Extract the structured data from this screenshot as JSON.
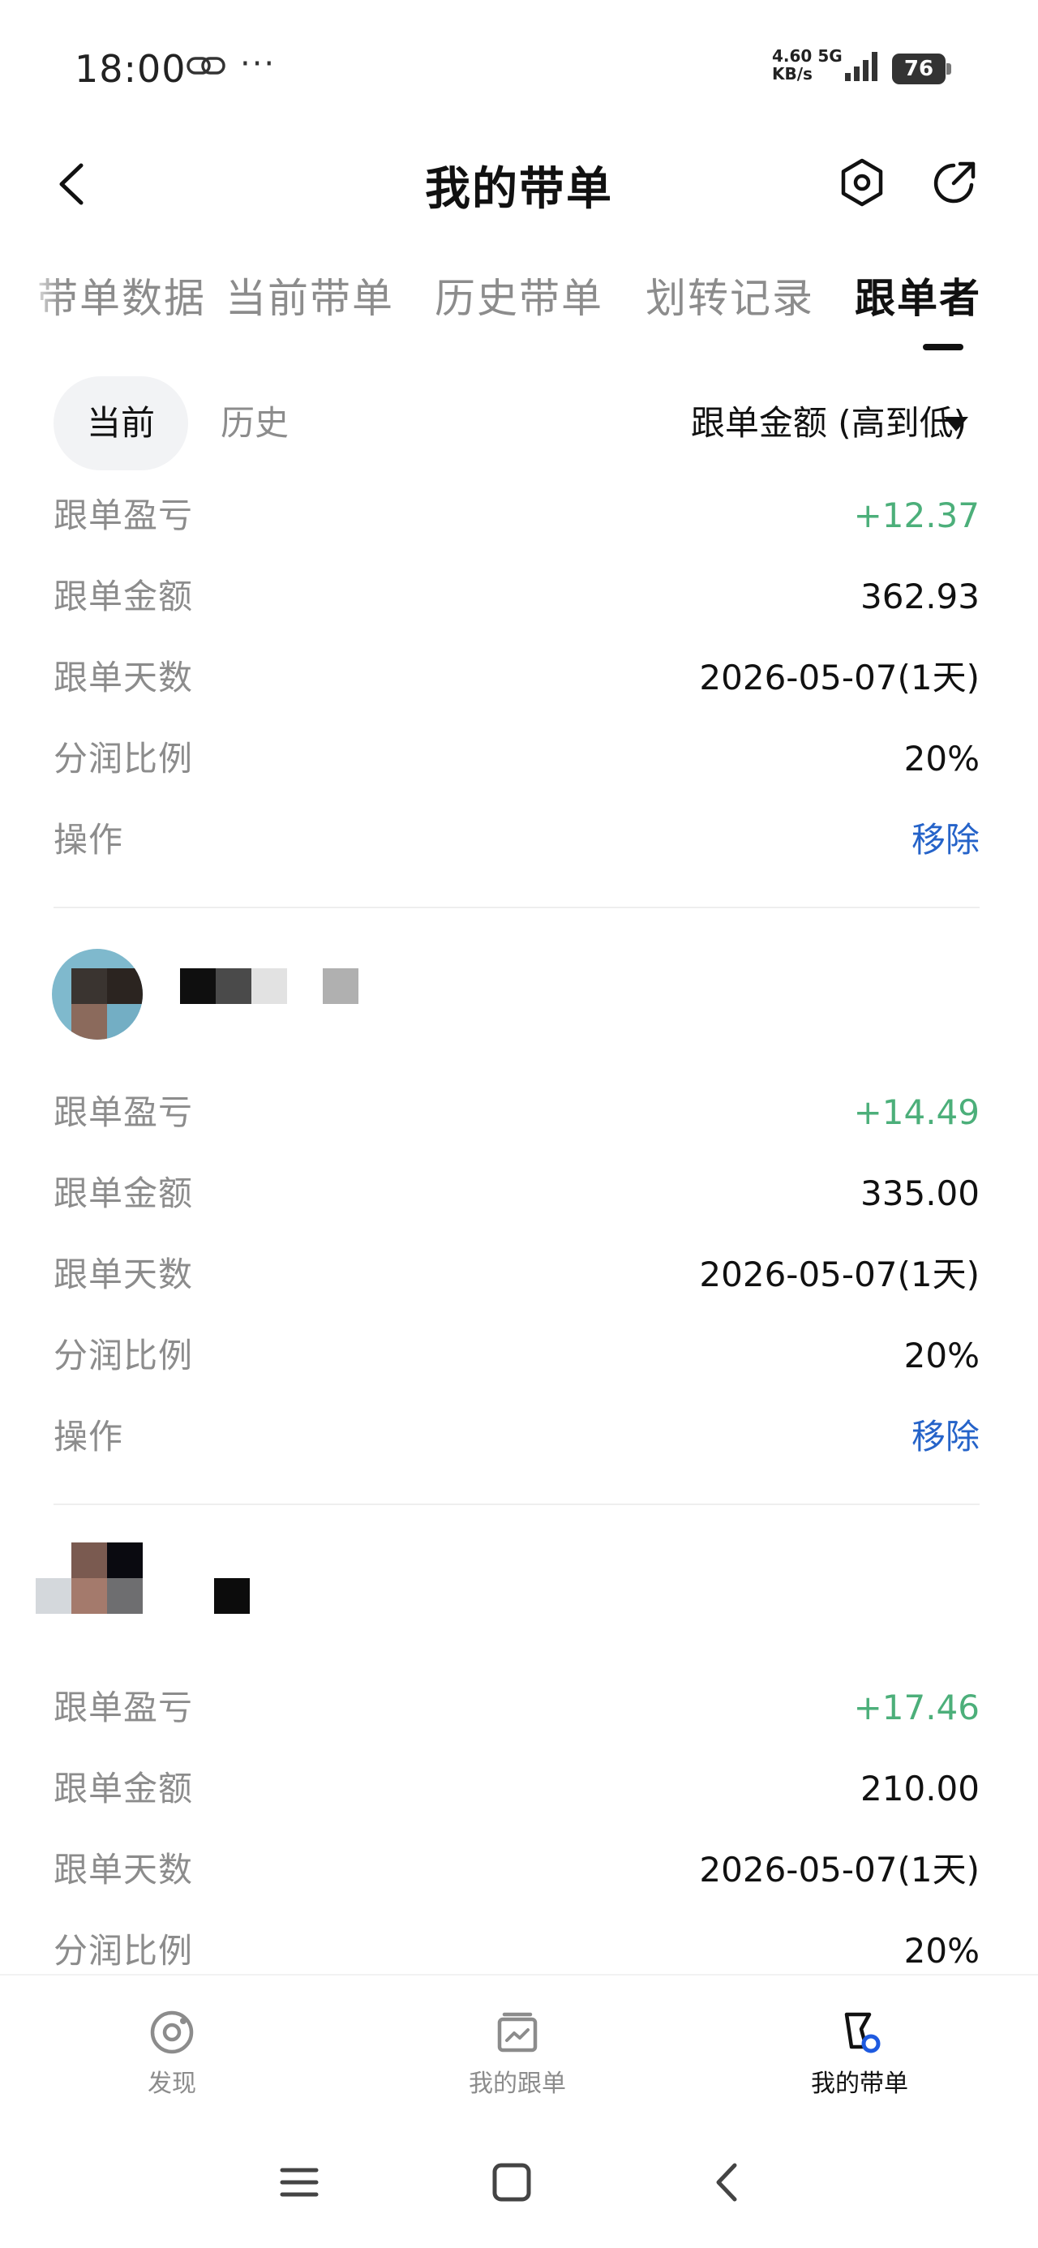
{
  "status_bar": {
    "time": "18:00",
    "dots": "···",
    "net_speed": "4.60",
    "net_unit": "KB/s",
    "net_type": "5G",
    "battery": "76"
  },
  "header": {
    "title": "我的带单",
    "back_icon": "chevron-left-icon",
    "settings_icon": "hexagon-settings-icon",
    "share_icon": "share-icon"
  },
  "tabs": [
    {
      "label": "带单数据"
    },
    {
      "label": "当前带单"
    },
    {
      "label": "历史带单"
    },
    {
      "label": "划转记录"
    },
    {
      "label": "跟单者",
      "active": true
    }
  ],
  "filter": {
    "segments": [
      "当前",
      "历史"
    ],
    "selected_segment": "当前",
    "sort_label": "跟单金额 (高到低)"
  },
  "followers": [
    {
      "rows": [
        {
          "label": "跟单盈亏",
          "value": "+12.37"
        },
        {
          "label": "跟单金额",
          "value": "362.93"
        },
        {
          "label": "跟单天数",
          "value": "2026-05-07(1天)"
        },
        {
          "label": "分润比例",
          "value": "20%"
        },
        {
          "label": "操作",
          "value": "移除"
        }
      ]
    },
    {
      "rows": [
        {
          "label": "跟单盈亏",
          "value": "+14.49"
        },
        {
          "label": "跟单金额",
          "value": "335.00"
        },
        {
          "label": "跟单天数",
          "value": "2026-05-07(1天)"
        },
        {
          "label": "分润比例",
          "value": "20%"
        },
        {
          "label": "操作",
          "value": "移除"
        }
      ]
    },
    {
      "rows": [
        {
          "label": "跟单盈亏",
          "value": "+17.46"
        },
        {
          "label": "跟单金额",
          "value": "210.00"
        },
        {
          "label": "跟单天数",
          "value": "2026-05-07(1天)"
        },
        {
          "label": "分润比例",
          "value": "20%"
        }
      ]
    }
  ],
  "bottom_nav": [
    {
      "label": "发现",
      "icon": "discover-icon"
    },
    {
      "label": "我的跟单",
      "icon": "my-follow-icon"
    },
    {
      "label": "我的带单",
      "icon": "my-lead-icon",
      "active": true
    }
  ],
  "colors": {
    "profit": "#4caf7a",
    "action": "#2563c9",
    "muted": "#8c8c8c",
    "text": "#111111"
  }
}
